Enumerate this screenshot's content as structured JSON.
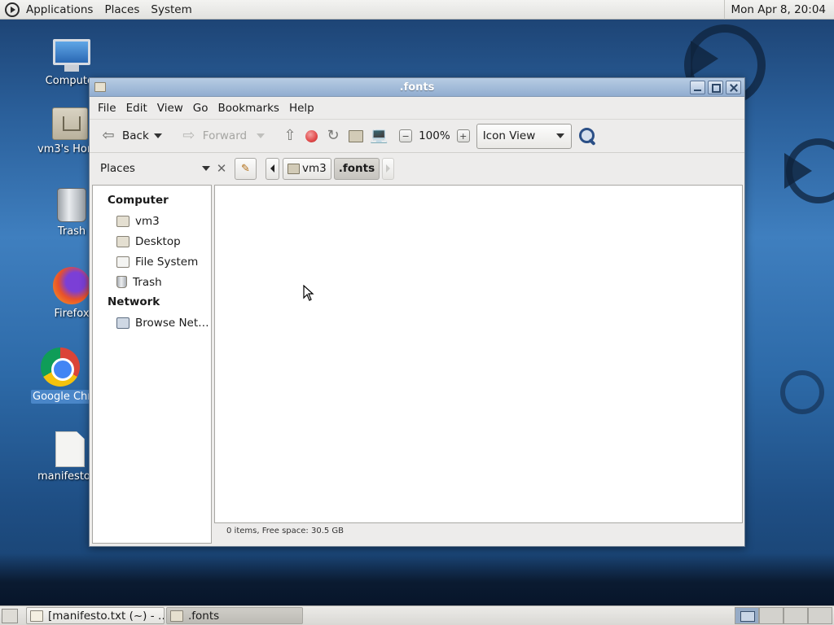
{
  "top_panel": {
    "menus": [
      "Applications",
      "Places",
      "System"
    ],
    "clock": "Mon Apr  8, 20:04"
  },
  "desktop": {
    "icons": [
      {
        "label": "Computer",
        "icon": "computer-icon"
      },
      {
        "label": "vm3's Home",
        "icon": "home-folder-icon"
      },
      {
        "label": "Trash",
        "icon": "trash-icon"
      },
      {
        "label": "Firefox",
        "icon": "firefox-icon"
      },
      {
        "label": "Google Chrome",
        "icon": "chrome-icon",
        "selected": true
      },
      {
        "label": "manifesto.txt",
        "icon": "text-file-icon"
      }
    ]
  },
  "window": {
    "title": ".fonts",
    "menubar": [
      "File",
      "Edit",
      "View",
      "Go",
      "Bookmarks",
      "Help"
    ],
    "toolbar": {
      "back": "Back",
      "forward": "Forward",
      "zoom": "100%",
      "view_mode": "Icon View"
    },
    "sidebar_selector": "Places",
    "breadcrumbs": [
      "vm3",
      ".fonts"
    ],
    "places": {
      "computer_heading": "Computer",
      "computer_items": [
        "vm3",
        "Desktop",
        "File System",
        "Trash"
      ],
      "network_heading": "Network",
      "network_items": [
        "Browse Net…"
      ]
    },
    "status": "0 items, Free space: 30.5 GB"
  },
  "taskbar": {
    "tasks": [
      "[manifesto.txt (~) - …",
      ".fonts"
    ]
  },
  "colors": {
    "titlebar": "#91add0",
    "desktop": "#2a5f9a",
    "selection": "#4a86c8"
  }
}
